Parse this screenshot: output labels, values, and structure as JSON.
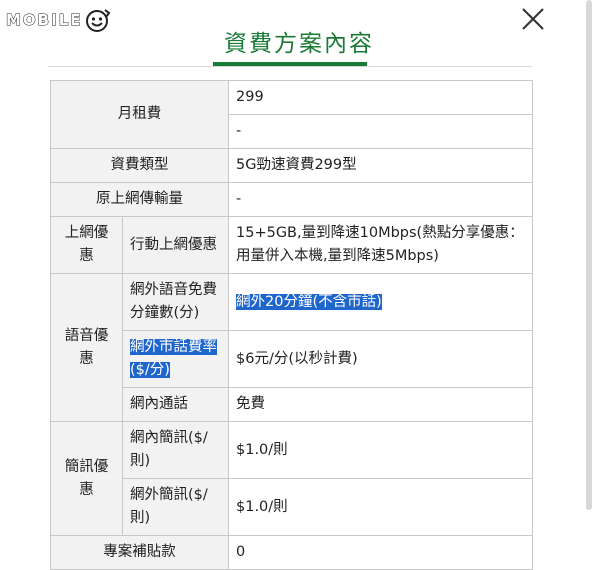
{
  "brand": {
    "logo_text": "MOBILE"
  },
  "dialog": {
    "title": "資費方案內容",
    "close_icon": "close-icon"
  },
  "table": {
    "monthly_fee_label": "月租費",
    "monthly_fee_value": "299",
    "monthly_fee_value2": "-",
    "plan_type_label": "資費類型",
    "plan_type_value": "5G勁速資費299型",
    "original_data_label": "原上網傳輸量",
    "original_data_value": "-",
    "internet_promo_label": "上網優惠",
    "mobile_data_label": "行動上網優惠",
    "mobile_data_value": "15+5GB,量到降速10Mbps(熱點分享優惠：用量併入本機,量到降速5Mbps)",
    "voice_promo_label": "語音優惠",
    "offnet_free_label": "網外語音免費分鐘數(分)",
    "offnet_free_value": "網外20分鐘(不含市話)",
    "offnet_landline_label": "網外市話費率($/分)",
    "offnet_landline_value": "$6元/分(以秒計費)",
    "onnet_call_label": "網內通話",
    "onnet_call_value": "免費",
    "sms_promo_label": "簡訊優惠",
    "onnet_sms_label": "網內簡訊($/則)",
    "onnet_sms_value": "$1.0/則",
    "offnet_sms_label": "網外簡訊($/則)",
    "offnet_sms_value": "$1.0/則",
    "subsidy_label": "專案補貼款",
    "subsidy_value": "0"
  },
  "colors": {
    "accent": "#1a7a36",
    "selection": "#1f66cc",
    "label_bg": "#f2f2f2",
    "border": "#c8c8c8"
  }
}
